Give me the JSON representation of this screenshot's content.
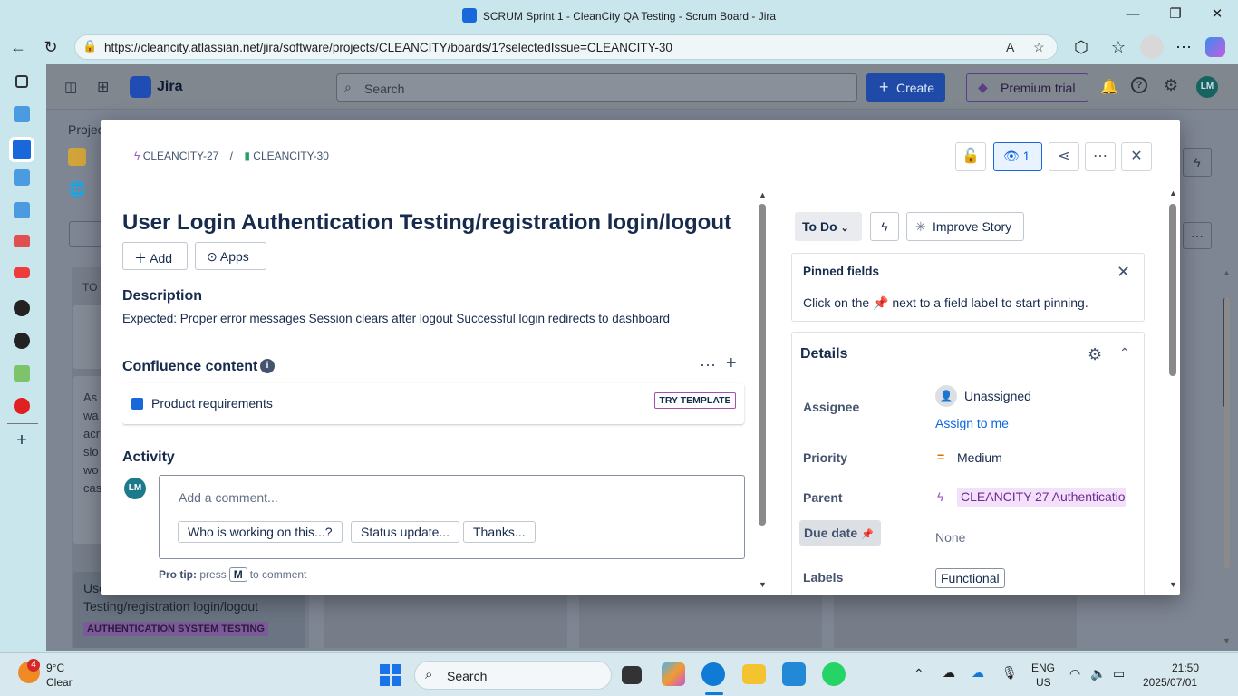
{
  "browser": {
    "window_title": "SCRUM Sprint 1 - CleanCity QA Testing - Scrum Board - Jira",
    "url": "https://cleancity.atlassian.net/jira/software/projects/CLEANCITY/boards/1?selectedIssue=CLEANCITY-30"
  },
  "jira": {
    "app_name": "Jira",
    "search_placeholder": "Search",
    "create_label": "Create",
    "premium_label": "Premium trial",
    "user_initials": "LM"
  },
  "issue": {
    "breadcrumb_parent": "CLEANCITY-27",
    "breadcrumb_sep": "/",
    "breadcrumb_key": "CLEANCITY-30",
    "watch_count": "1",
    "title": "User Login Authentication Testing/registration login/logout",
    "add_label": "Add",
    "apps_label": "Apps",
    "description_heading": "Description",
    "description": "Expected:  Proper error messages  Session clears after logout  Successful login redirects to dashboard",
    "confluence_heading": "Confluence content",
    "confluence_item": "Product requirements",
    "try_template": "TRY TEMPLATE",
    "activity_heading": "Activity",
    "comment_initials": "LM",
    "comment_placeholder": "Add a comment...",
    "quick_replies": [
      "Who is working on this...?",
      "Status update...",
      "Thanks..."
    ],
    "tip_prefix": "Pro tip:",
    "tip_press": "press",
    "tip_key": "M",
    "tip_suffix": "to comment"
  },
  "side": {
    "status": "To Do",
    "improve_label": "Improve Story",
    "pinned_heading": "Pinned fields",
    "pinned_text_before": "Click on the",
    "pinned_text_after": "next to a field label to start pinning.",
    "details_heading": "Details",
    "fields": {
      "assignee_label": "Assignee",
      "assignee_value": "Unassigned",
      "assign_to_me": "Assign to me",
      "priority_label": "Priority",
      "priority_value": "Medium",
      "parent_label": "Parent",
      "parent_value": "CLEANCITY-27 Authenticatio",
      "due_label": "Due date",
      "due_value": "None",
      "labels_label": "Labels",
      "labels_value": "Functional"
    }
  },
  "board_background": {
    "project_abbrev": "Projec",
    "column_label": "TO",
    "card_text_a": [
      "As",
      "wa",
      "acr",
      "slo",
      "wo",
      "cas"
    ],
    "card_title_b": "Use",
    "card_title_b2": "Testing/registration login/logout",
    "epic_badge": "AUTHENTICATION SYSTEM TESTING"
  },
  "taskbar": {
    "weather_badge": "4",
    "temp": "9°C",
    "condition": "Clear",
    "search_label": "Search",
    "lang1": "ENG",
    "lang2": "US",
    "time": "21:50",
    "date": "2025/07/01"
  }
}
